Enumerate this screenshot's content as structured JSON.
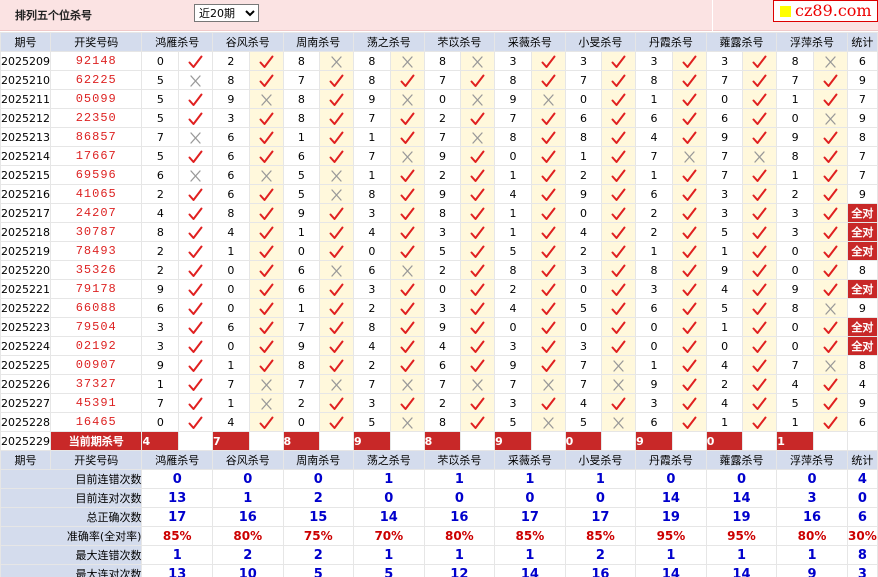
{
  "header": {
    "title": "排列五个位杀号",
    "period_select": "近20期",
    "logo": "cz89.com"
  },
  "columns": [
    "期号",
    "开奖号码",
    "鸿雁杀号",
    "谷风杀号",
    "周南杀号",
    "荡之杀号",
    "芣苡杀号",
    "采薇杀号",
    "小旻杀号",
    "丹霞杀号",
    "蕹露杀号",
    "浮萍杀号",
    "统计"
  ],
  "rows": [
    {
      "period": "2025209",
      "nums": "92148",
      "kills": [
        [
          0,
          1
        ],
        [
          2,
          1
        ],
        [
          8,
          0
        ],
        [
          8,
          0
        ],
        [
          8,
          0
        ],
        [
          3,
          1
        ],
        [
          3,
          1
        ],
        [
          3,
          1
        ],
        [
          3,
          1
        ],
        [
          8,
          0
        ]
      ],
      "stat": "6"
    },
    {
      "period": "2025210",
      "nums": "62225",
      "kills": [
        [
          5,
          0
        ],
        [
          8,
          1
        ],
        [
          7,
          1
        ],
        [
          8,
          1
        ],
        [
          7,
          1
        ],
        [
          8,
          1
        ],
        [
          7,
          1
        ],
        [
          8,
          1
        ],
        [
          7,
          1
        ],
        [
          7,
          1
        ]
      ],
      "stat": "9"
    },
    {
      "period": "2025211",
      "nums": "05099",
      "kills": [
        [
          5,
          1
        ],
        [
          9,
          0
        ],
        [
          8,
          1
        ],
        [
          9,
          0
        ],
        [
          0,
          0
        ],
        [
          9,
          0
        ],
        [
          0,
          1
        ],
        [
          1,
          1
        ],
        [
          0,
          1
        ],
        [
          1,
          1
        ]
      ],
      "stat": "7"
    },
    {
      "period": "2025212",
      "nums": "22350",
      "kills": [
        [
          5,
          1
        ],
        [
          3,
          1
        ],
        [
          8,
          1
        ],
        [
          7,
          1
        ],
        [
          2,
          1
        ],
        [
          7,
          1
        ],
        [
          6,
          1
        ],
        [
          6,
          1
        ],
        [
          6,
          1
        ],
        [
          0,
          0
        ]
      ],
      "stat": "9"
    },
    {
      "period": "2025213",
      "nums": "86857",
      "kills": [
        [
          7,
          0
        ],
        [
          6,
          1
        ],
        [
          1,
          1
        ],
        [
          1,
          1
        ],
        [
          7,
          0
        ],
        [
          8,
          1
        ],
        [
          8,
          1
        ],
        [
          4,
          1
        ],
        [
          9,
          1
        ],
        [
          9,
          1
        ]
      ],
      "stat": "8"
    },
    {
      "period": "2025214",
      "nums": "17667",
      "kills": [
        [
          5,
          1
        ],
        [
          6,
          1
        ],
        [
          6,
          1
        ],
        [
          7,
          0
        ],
        [
          9,
          1
        ],
        [
          0,
          1
        ],
        [
          1,
          1
        ],
        [
          7,
          0
        ],
        [
          7,
          0
        ],
        [
          8,
          1
        ]
      ],
      "stat": "7"
    },
    {
      "period": "2025215",
      "nums": "69596",
      "kills": [
        [
          6,
          0
        ],
        [
          6,
          0
        ],
        [
          5,
          0
        ],
        [
          1,
          1
        ],
        [
          2,
          1
        ],
        [
          1,
          1
        ],
        [
          2,
          1
        ],
        [
          1,
          1
        ],
        [
          7,
          1
        ],
        [
          1,
          1
        ]
      ],
      "stat": "7"
    },
    {
      "period": "2025216",
      "nums": "41065",
      "kills": [
        [
          2,
          1
        ],
        [
          6,
          1
        ],
        [
          5,
          0
        ],
        [
          8,
          1
        ],
        [
          9,
          1
        ],
        [
          4,
          1
        ],
        [
          9,
          1
        ],
        [
          6,
          1
        ],
        [
          3,
          1
        ],
        [
          2,
          1
        ]
      ],
      "stat": "9"
    },
    {
      "period": "2025217",
      "nums": "24207",
      "kills": [
        [
          4,
          1
        ],
        [
          8,
          1
        ],
        [
          9,
          1
        ],
        [
          3,
          1
        ],
        [
          8,
          1
        ],
        [
          1,
          1
        ],
        [
          0,
          1
        ],
        [
          2,
          1
        ],
        [
          3,
          1
        ],
        [
          3,
          1
        ]
      ],
      "stat": "全对"
    },
    {
      "period": "2025218",
      "nums": "30787",
      "kills": [
        [
          8,
          1
        ],
        [
          4,
          1
        ],
        [
          1,
          1
        ],
        [
          4,
          1
        ],
        [
          3,
          1
        ],
        [
          1,
          1
        ],
        [
          4,
          1
        ],
        [
          2,
          1
        ],
        [
          5,
          1
        ],
        [
          3,
          1
        ]
      ],
      "stat": "全对"
    },
    {
      "period": "2025219",
      "nums": "78493",
      "kills": [
        [
          2,
          1
        ],
        [
          1,
          1
        ],
        [
          0,
          1
        ],
        [
          0,
          1
        ],
        [
          5,
          1
        ],
        [
          5,
          1
        ],
        [
          2,
          1
        ],
        [
          1,
          1
        ],
        [
          1,
          1
        ],
        [
          0,
          1
        ]
      ],
      "stat": "全对"
    },
    {
      "period": "2025220",
      "nums": "35326",
      "kills": [
        [
          2,
          1
        ],
        [
          0,
          1
        ],
        [
          6,
          0
        ],
        [
          6,
          0
        ],
        [
          2,
          1
        ],
        [
          8,
          1
        ],
        [
          3,
          1
        ],
        [
          8,
          1
        ],
        [
          9,
          1
        ],
        [
          0,
          1
        ]
      ],
      "stat": "8"
    },
    {
      "period": "2025221",
      "nums": "79178",
      "kills": [
        [
          9,
          1
        ],
        [
          0,
          1
        ],
        [
          6,
          1
        ],
        [
          3,
          1
        ],
        [
          0,
          1
        ],
        [
          2,
          1
        ],
        [
          0,
          1
        ],
        [
          3,
          1
        ],
        [
          4,
          1
        ],
        [
          9,
          1
        ]
      ],
      "stat": "全对"
    },
    {
      "period": "2025222",
      "nums": "66088",
      "kills": [
        [
          6,
          1
        ],
        [
          0,
          1
        ],
        [
          1,
          1
        ],
        [
          2,
          1
        ],
        [
          3,
          1
        ],
        [
          4,
          1
        ],
        [
          5,
          1
        ],
        [
          6,
          1
        ],
        [
          5,
          1
        ],
        [
          8,
          0
        ]
      ],
      "stat": "9"
    },
    {
      "period": "2025223",
      "nums": "79504",
      "kills": [
        [
          3,
          1
        ],
        [
          6,
          1
        ],
        [
          7,
          1
        ],
        [
          8,
          1
        ],
        [
          9,
          1
        ],
        [
          0,
          1
        ],
        [
          0,
          1
        ],
        [
          0,
          1
        ],
        [
          1,
          1
        ],
        [
          0,
          1
        ]
      ],
      "stat": "全对"
    },
    {
      "period": "2025224",
      "nums": "02192",
      "kills": [
        [
          3,
          1
        ],
        [
          0,
          1
        ],
        [
          9,
          1
        ],
        [
          4,
          1
        ],
        [
          4,
          1
        ],
        [
          3,
          1
        ],
        [
          3,
          1
        ],
        [
          0,
          1
        ],
        [
          0,
          1
        ],
        [
          0,
          1
        ]
      ],
      "stat": "全对"
    },
    {
      "period": "2025225",
      "nums": "00907",
      "kills": [
        [
          9,
          1
        ],
        [
          1,
          1
        ],
        [
          8,
          1
        ],
        [
          2,
          1
        ],
        [
          6,
          1
        ],
        [
          9,
          1
        ],
        [
          7,
          0
        ],
        [
          1,
          1
        ],
        [
          4,
          1
        ],
        [
          7,
          0
        ]
      ],
      "stat": "8"
    },
    {
      "period": "2025226",
      "nums": "37327",
      "kills": [
        [
          1,
          1
        ],
        [
          7,
          0
        ],
        [
          7,
          0
        ],
        [
          7,
          0
        ],
        [
          7,
          0
        ],
        [
          7,
          0
        ],
        [
          7,
          0
        ],
        [
          9,
          1
        ],
        [
          2,
          1
        ],
        [
          4,
          1
        ]
      ],
      "stat": "4"
    },
    {
      "period": "2025227",
      "nums": "45391",
      "kills": [
        [
          7,
          1
        ],
        [
          1,
          0
        ],
        [
          2,
          1
        ],
        [
          3,
          1
        ],
        [
          2,
          1
        ],
        [
          3,
          1
        ],
        [
          4,
          1
        ],
        [
          3,
          1
        ],
        [
          4,
          1
        ],
        [
          5,
          1
        ]
      ],
      "stat": "9"
    },
    {
      "period": "2025228",
      "nums": "16465",
      "kills": [
        [
          0,
          1
        ],
        [
          4,
          1
        ],
        [
          0,
          1
        ],
        [
          5,
          0
        ],
        [
          8,
          1
        ],
        [
          5,
          0
        ],
        [
          5,
          0
        ],
        [
          6,
          1
        ],
        [
          1,
          1
        ],
        [
          1,
          1
        ]
      ],
      "stat": "6"
    }
  ],
  "current": {
    "period": "2025229",
    "label": "当前期杀号",
    "values": [
      "4",
      "7",
      "8",
      "9",
      "8",
      "9",
      "0",
      "9",
      "0",
      "1"
    ]
  },
  "summary": [
    {
      "label": "目前连错次数",
      "values": [
        "0",
        "0",
        "0",
        "1",
        "1",
        "1",
        "1",
        "0",
        "0",
        "0",
        "4"
      ]
    },
    {
      "label": "目前连对次数",
      "values": [
        "13",
        "1",
        "2",
        "0",
        "0",
        "0",
        "0",
        "14",
        "14",
        "3",
        "0"
      ]
    },
    {
      "label": "总正确次数",
      "values": [
        "17",
        "16",
        "15",
        "14",
        "16",
        "17",
        "17",
        "19",
        "19",
        "16",
        "6"
      ]
    },
    {
      "label": "准确率(全对率)",
      "values": [
        "85%",
        "80%",
        "75%",
        "70%",
        "80%",
        "85%",
        "85%",
        "95%",
        "95%",
        "80%",
        "30%"
      ]
    },
    {
      "label": "最大连错次数",
      "values": [
        "1",
        "2",
        "2",
        "1",
        "1",
        "1",
        "2",
        "1",
        "1",
        "1",
        "8"
      ]
    },
    {
      "label": "最大连对次数",
      "values": [
        "13",
        "10",
        "5",
        "5",
        "12",
        "14",
        "16",
        "14",
        "14",
        "9",
        "3"
      ]
    }
  ]
}
